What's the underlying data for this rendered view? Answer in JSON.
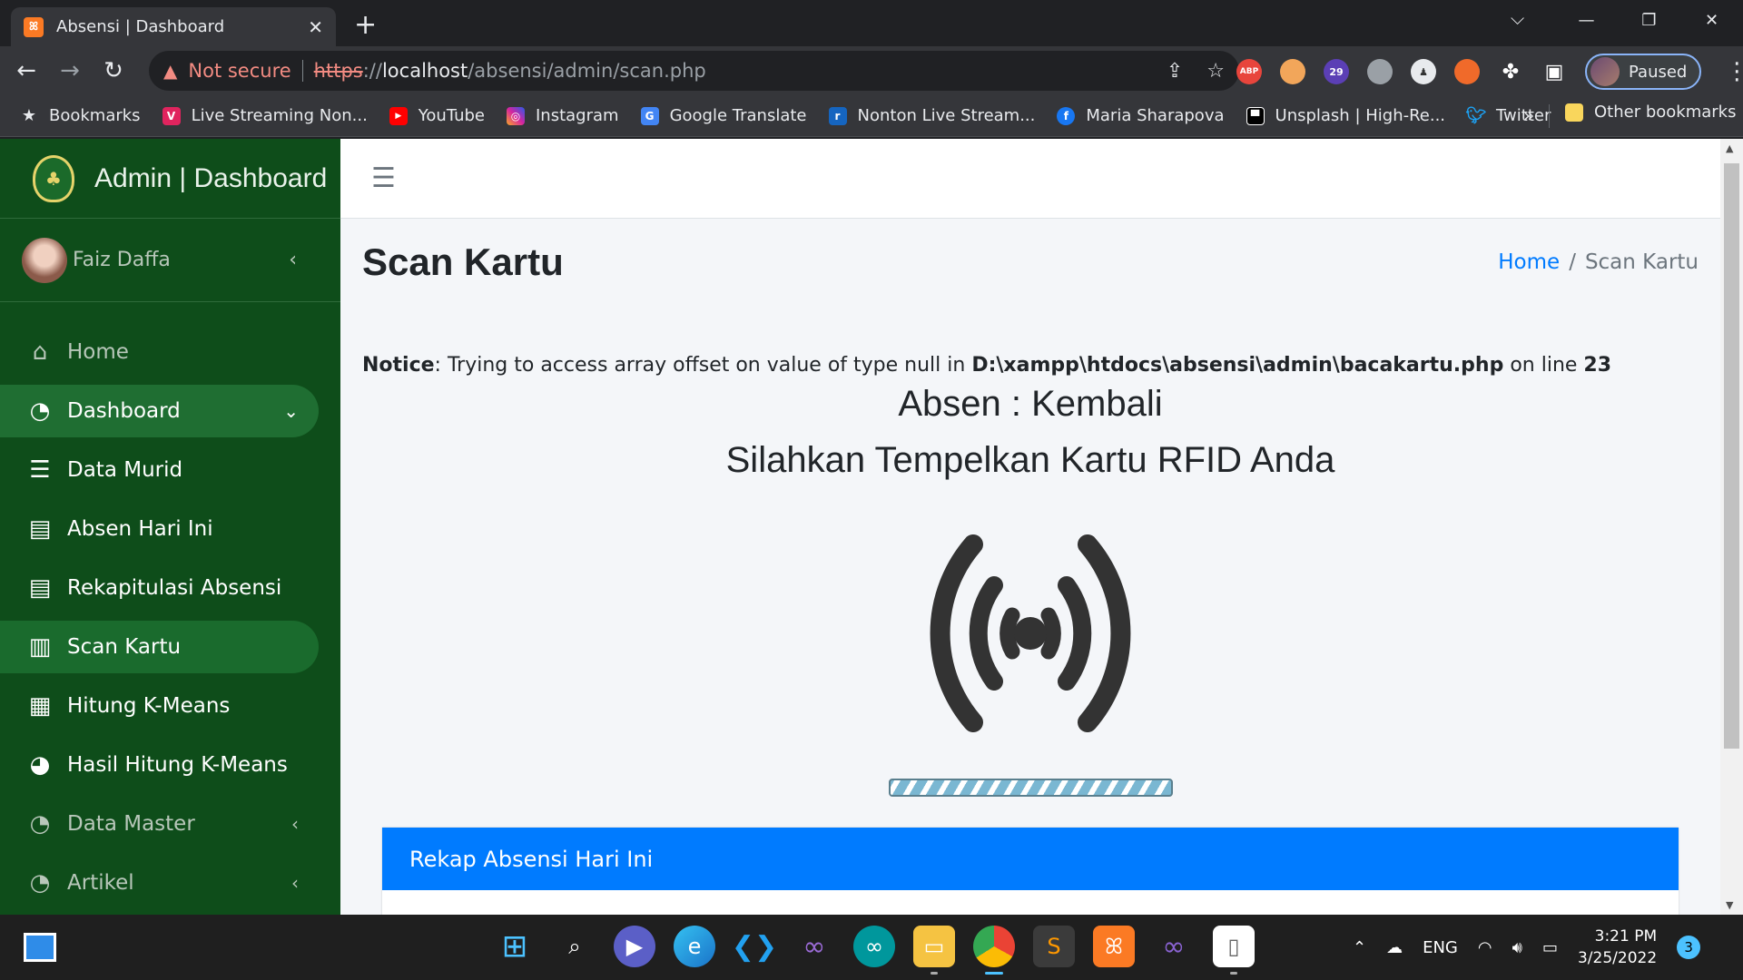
{
  "browser": {
    "tab_title": "Absensi | Dashboard",
    "new_tab_symbol": "+",
    "security_label": "Not secure",
    "url_protocol": "https",
    "url_separator": "://",
    "url_host": "localhost",
    "url_path": "/absensi/admin/scan.php",
    "profile_label": "Paused",
    "extensions": [
      "ABP",
      "29"
    ],
    "bookmarks": [
      {
        "label": "Bookmarks",
        "icon": "star-icon"
      },
      {
        "label": "Live Streaming Non...",
        "icon": "vidio-icon"
      },
      {
        "label": "YouTube",
        "icon": "youtube-icon"
      },
      {
        "label": "Instagram",
        "icon": "instagram-icon"
      },
      {
        "label": "Google Translate",
        "icon": "google-translate-icon"
      },
      {
        "label": "Nonton Live Stream...",
        "icon": "stream-icon"
      },
      {
        "label": "Maria Sharapova",
        "icon": "facebook-icon"
      },
      {
        "label": "Unsplash | High-Re...",
        "icon": "unsplash-icon"
      },
      {
        "label": "Twitter",
        "icon": "twitter-icon"
      }
    ],
    "bookmarks_more": "»",
    "other_bookmarks": "Other bookmarks"
  },
  "sidebar": {
    "brand": "Admin | Dashboard",
    "user_name": "Faiz Daffa",
    "items": [
      {
        "label": "Home",
        "icon": "home-icon"
      },
      {
        "label": "Dashboard",
        "icon": "tachometer-icon"
      },
      {
        "label": "Data Murid",
        "icon": "database-icon"
      },
      {
        "label": "Absen Hari Ini",
        "icon": "book-icon"
      },
      {
        "label": "Rekapitulasi Absensi",
        "icon": "book-icon"
      },
      {
        "label": "Scan Kartu",
        "icon": "barcode-icon"
      },
      {
        "label": "Hitung K-Means",
        "icon": "calculator-icon"
      },
      {
        "label": "Hasil Hitung K-Means",
        "icon": "pie-chart-icon"
      },
      {
        "label": "Data Master",
        "icon": "tachometer-icon"
      },
      {
        "label": "Artikel",
        "icon": "tachometer-icon"
      }
    ]
  },
  "main": {
    "page_title": "Scan Kartu",
    "breadcrumb": {
      "home": "Home",
      "separator": "/",
      "current": "Scan Kartu"
    },
    "notice": {
      "label": "Notice",
      "message": ": Trying to access array offset on value of type null in ",
      "file": "D:\\xampp\\htdocs\\absensi\\admin\\bacakartu.php",
      "line_text": " on line ",
      "line": "23"
    },
    "absen_mode": "Absen : Kembali",
    "instruction": "Silahkan Tempelkan Kartu RFID Anda",
    "card_title": "Rekap Absensi Hari Ini"
  },
  "taskbar": {
    "tray_language": "ENG",
    "time": "3:21 PM",
    "date": "3/25/2022",
    "notification_count": "3"
  },
  "colors": {
    "sidebar_bg": "#0e4d1a",
    "accent_blue": "#007bff",
    "content_bg": "#f4f6f9"
  }
}
